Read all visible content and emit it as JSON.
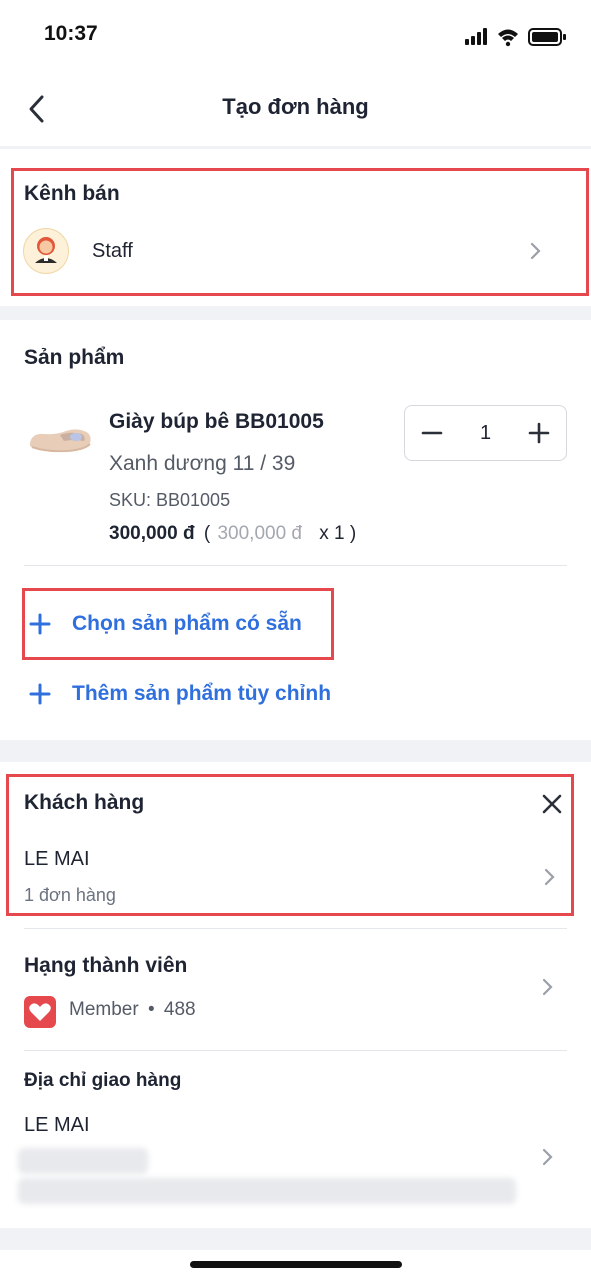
{
  "status_bar": {
    "time": "10:37"
  },
  "header": {
    "title": "Tạo đơn hàng"
  },
  "sales_channel": {
    "title": "Kênh bán",
    "value": "Staff"
  },
  "products": {
    "title": "Sản phẩm",
    "items": [
      {
        "name": "Giày búp bê BB01005",
        "variant": "Xanh dương 11 / 39",
        "sku": "SKU: BB01005",
        "price": "300,000 đ",
        "paren_open": "(",
        "original_price": "300,000 đ",
        "multiplier": "x 1",
        "paren_close": ")",
        "quantity": "1"
      }
    ],
    "choose_existing_label": "Chọn sản phẩm có sẵn",
    "add_custom_label": "Thêm sản phẩm tùy chỉnh"
  },
  "customer": {
    "title": "Khách hàng",
    "name": "LE MAI",
    "orders": "1 đơn hàng"
  },
  "membership": {
    "title": "Hạng thành viên",
    "tier": "Member",
    "separator": "•",
    "points": "488"
  },
  "shipping": {
    "title": "Địa chỉ giao hàng",
    "name": "LE MAI"
  },
  "colors": {
    "accent": "#2f6fde",
    "highlight": "#e5484d",
    "member_badge": "#e5484d"
  }
}
